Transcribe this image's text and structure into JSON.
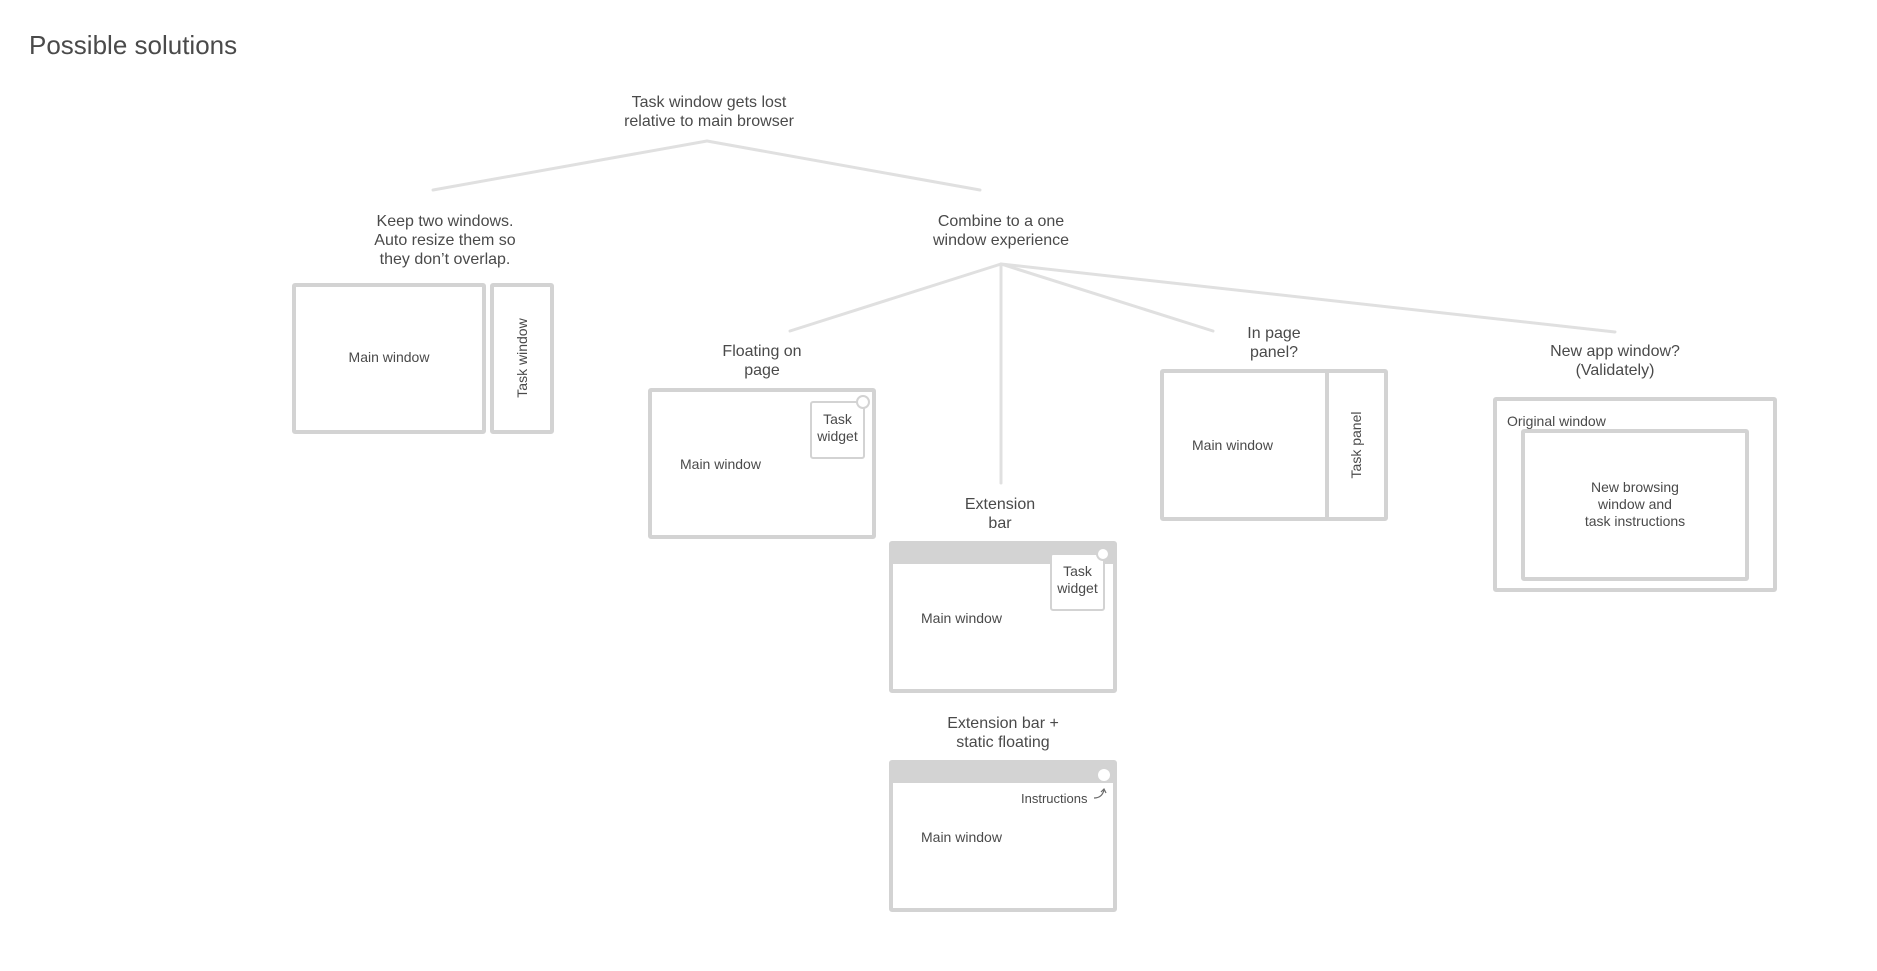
{
  "page": {
    "title": "Possible solutions"
  },
  "colors": {
    "text": "#4a4a4a",
    "stroke": "#d3d3d3",
    "connector": "#e0e0e0",
    "background": "#ffffff"
  },
  "tree": {
    "root": {
      "label": "Task window gets lost\nrelative to main browser"
    },
    "keep_two": {
      "label": "Keep two windows.\nAuto resize them so\nthey don’t overlap.",
      "main_window": "Main window",
      "task_window": "Task window"
    },
    "combine": {
      "label": "Combine to a one\nwindow experience"
    },
    "floating": {
      "label": "Floating on\npage",
      "main_window": "Main window",
      "widget": "Task\nwidget"
    },
    "extension_bar": {
      "label": "Extension\nbar",
      "main_window": "Main window",
      "widget": "Task\nwidget"
    },
    "extension_static": {
      "label": "Extension bar +\nstatic floating",
      "main_window": "Main window",
      "instructions": "Instructions",
      "arrow_icon": "curved-arrow-up"
    },
    "in_page_panel": {
      "label": "In page\npanel?",
      "main_window": "Main window",
      "task_panel": "Task panel"
    },
    "new_app": {
      "label": "New app window?\n(Validately)",
      "original_window": "Original window",
      "inner": "New browsing\nwindow and\ntask instructions"
    }
  }
}
